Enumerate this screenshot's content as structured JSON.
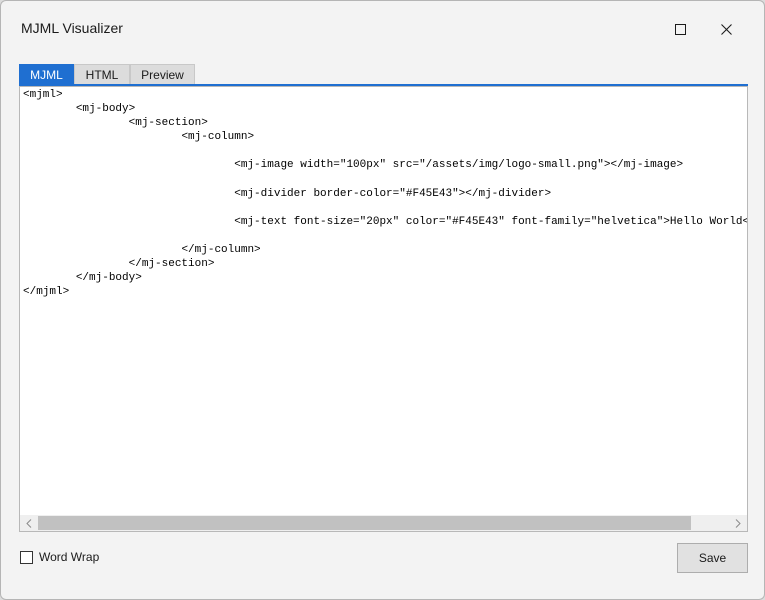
{
  "window": {
    "title": "MJML Visualizer"
  },
  "tabs": [
    {
      "label": "MJML",
      "active": true
    },
    {
      "label": "HTML",
      "active": false
    },
    {
      "label": "Preview",
      "active": false
    }
  ],
  "editor": {
    "code": "<mjml>\n\t<mj-body>\n\t\t<mj-section>\n\t\t\t<mj-column>\n\n\t\t\t\t<mj-image width=\"100px\" src=\"/assets/img/logo-small.png\"></mj-image>\n\n\t\t\t\t<mj-divider border-color=\"#F45E43\"></mj-divider>\n\n\t\t\t\t<mj-text font-size=\"20px\" color=\"#F45E43\" font-family=\"helvetica\">Hello World</mj-text>\n\n\t\t\t</mj-column>\n\t\t</mj-section>\n\t</mj-body>\n</mjml>"
  },
  "word_wrap": {
    "label": "Word Wrap",
    "checked": false
  },
  "save_button": {
    "label": "Save"
  },
  "colors": {
    "accent": "#1f6fd1",
    "background": "#f3f3f3"
  },
  "icons": {
    "maximize": "maximize-icon",
    "close": "close-icon",
    "scroll_left": "chevron-left-icon",
    "scroll_right": "chevron-right-icon"
  }
}
